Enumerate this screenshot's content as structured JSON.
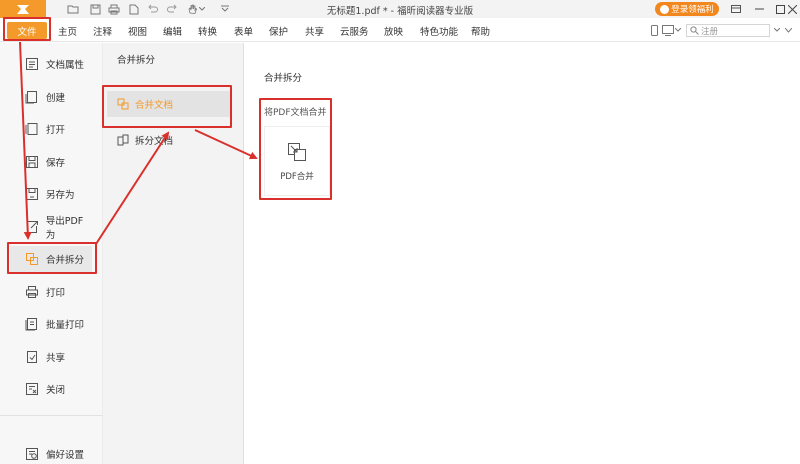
{
  "window": {
    "title": "无标题1.pdf * - 福昕阅读器专业版",
    "login_label": "登录领福利"
  },
  "menu": {
    "file": "文件",
    "items": [
      "主页",
      "注释",
      "视图",
      "编辑",
      "转换",
      "表单",
      "保护",
      "共享",
      "云服务",
      "放映",
      "特色功能",
      "帮助"
    ],
    "search_placeholder": "注册"
  },
  "sidebar": {
    "items": [
      {
        "label": "文档属性",
        "icon": "document-properties-icon"
      },
      {
        "label": "创建",
        "icon": "create-icon"
      },
      {
        "label": "打开",
        "icon": "open-icon"
      },
      {
        "label": "保存",
        "icon": "save-icon"
      },
      {
        "label": "另存为",
        "icon": "save-as-icon"
      },
      {
        "label": "导出PDF为",
        "icon": "export-pdf-icon"
      },
      {
        "label": "合并拆分",
        "icon": "merge-split-icon",
        "active": true
      },
      {
        "label": "打印",
        "icon": "print-icon"
      },
      {
        "label": "批量打印",
        "icon": "batch-print-icon"
      },
      {
        "label": "共享",
        "icon": "share-icon"
      },
      {
        "label": "关闭",
        "icon": "close-doc-icon"
      }
    ],
    "preferences": {
      "label": "偏好设置",
      "icon": "preferences-icon"
    }
  },
  "midpanel": {
    "title": "合并拆分",
    "items": [
      {
        "label": "合并文档",
        "icon": "merge-document-icon",
        "active": true
      },
      {
        "label": "拆分文档",
        "icon": "split-document-icon"
      }
    ]
  },
  "content": {
    "title": "合并拆分",
    "section_label": "将PDF文档合并",
    "card_label": "PDF合并"
  },
  "colors": {
    "accent": "#f39a2a",
    "annotation": "#d9302c"
  }
}
